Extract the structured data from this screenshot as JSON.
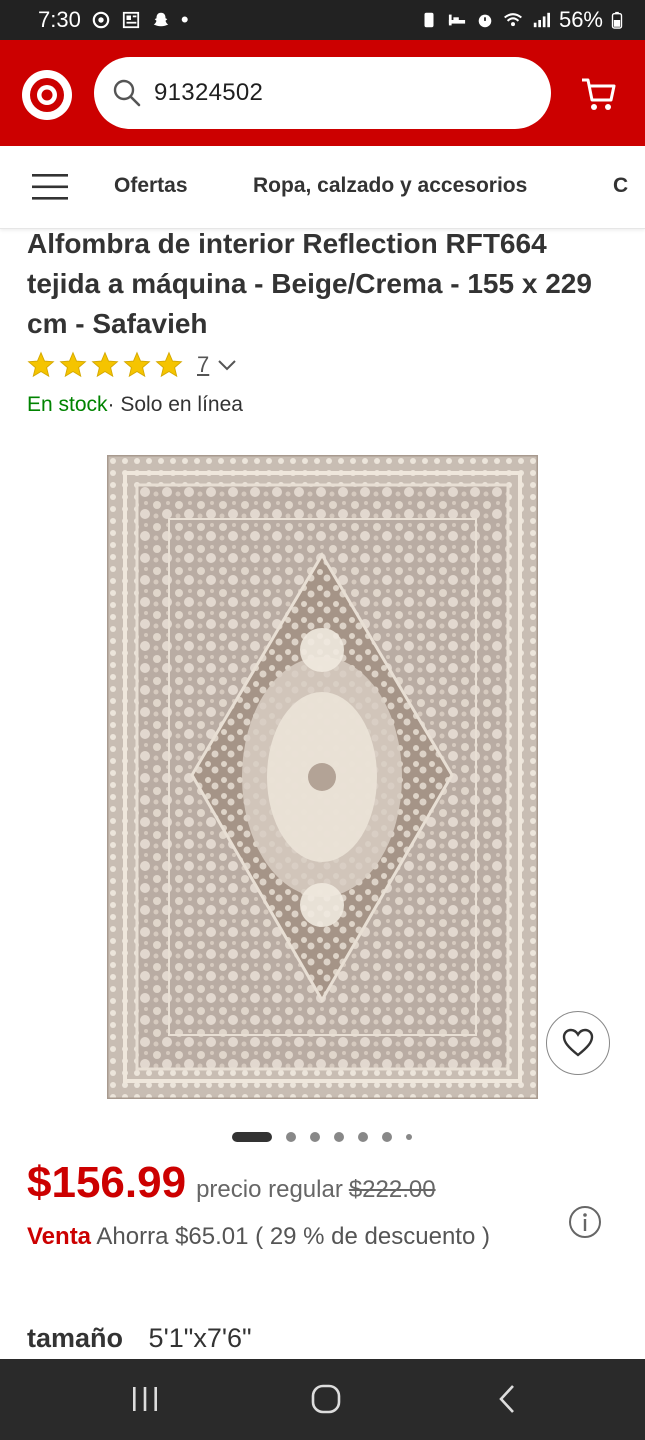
{
  "status_bar": {
    "time": "7:30",
    "dot": "•",
    "battery": "56%"
  },
  "header": {
    "search_value": "91324502",
    "icons": [
      "target-logo-icon",
      "search-icon",
      "cart-icon"
    ],
    "brand_color": "#cc0000"
  },
  "nav": {
    "items": [
      "Ofertas",
      "Ropa, calzado y accesorios",
      "C"
    ]
  },
  "product": {
    "title": "Alfombra de interior Reflection RFT664 tejida a máquina - Beige/Crema - 155 x 229 cm - Safavieh",
    "rating_stars": 5,
    "review_count": "7",
    "stock": "En stock",
    "availability": "· Solo en línea",
    "carousel_pages": 7,
    "carousel_active_index": 0
  },
  "price": {
    "current": "$156.99",
    "regular_label": "precio regular",
    "regular_value": "$222.00",
    "sale_label": "Venta",
    "savings_text": "Ahorra $65.01 ( 29 % de descuento )"
  },
  "size": {
    "label": "tamaño",
    "value": "5'1\"x7'6\""
  },
  "colors": {
    "accent_red": "#cc0000",
    "in_stock_green": "#008300",
    "star_yellow": "#f5c400"
  }
}
